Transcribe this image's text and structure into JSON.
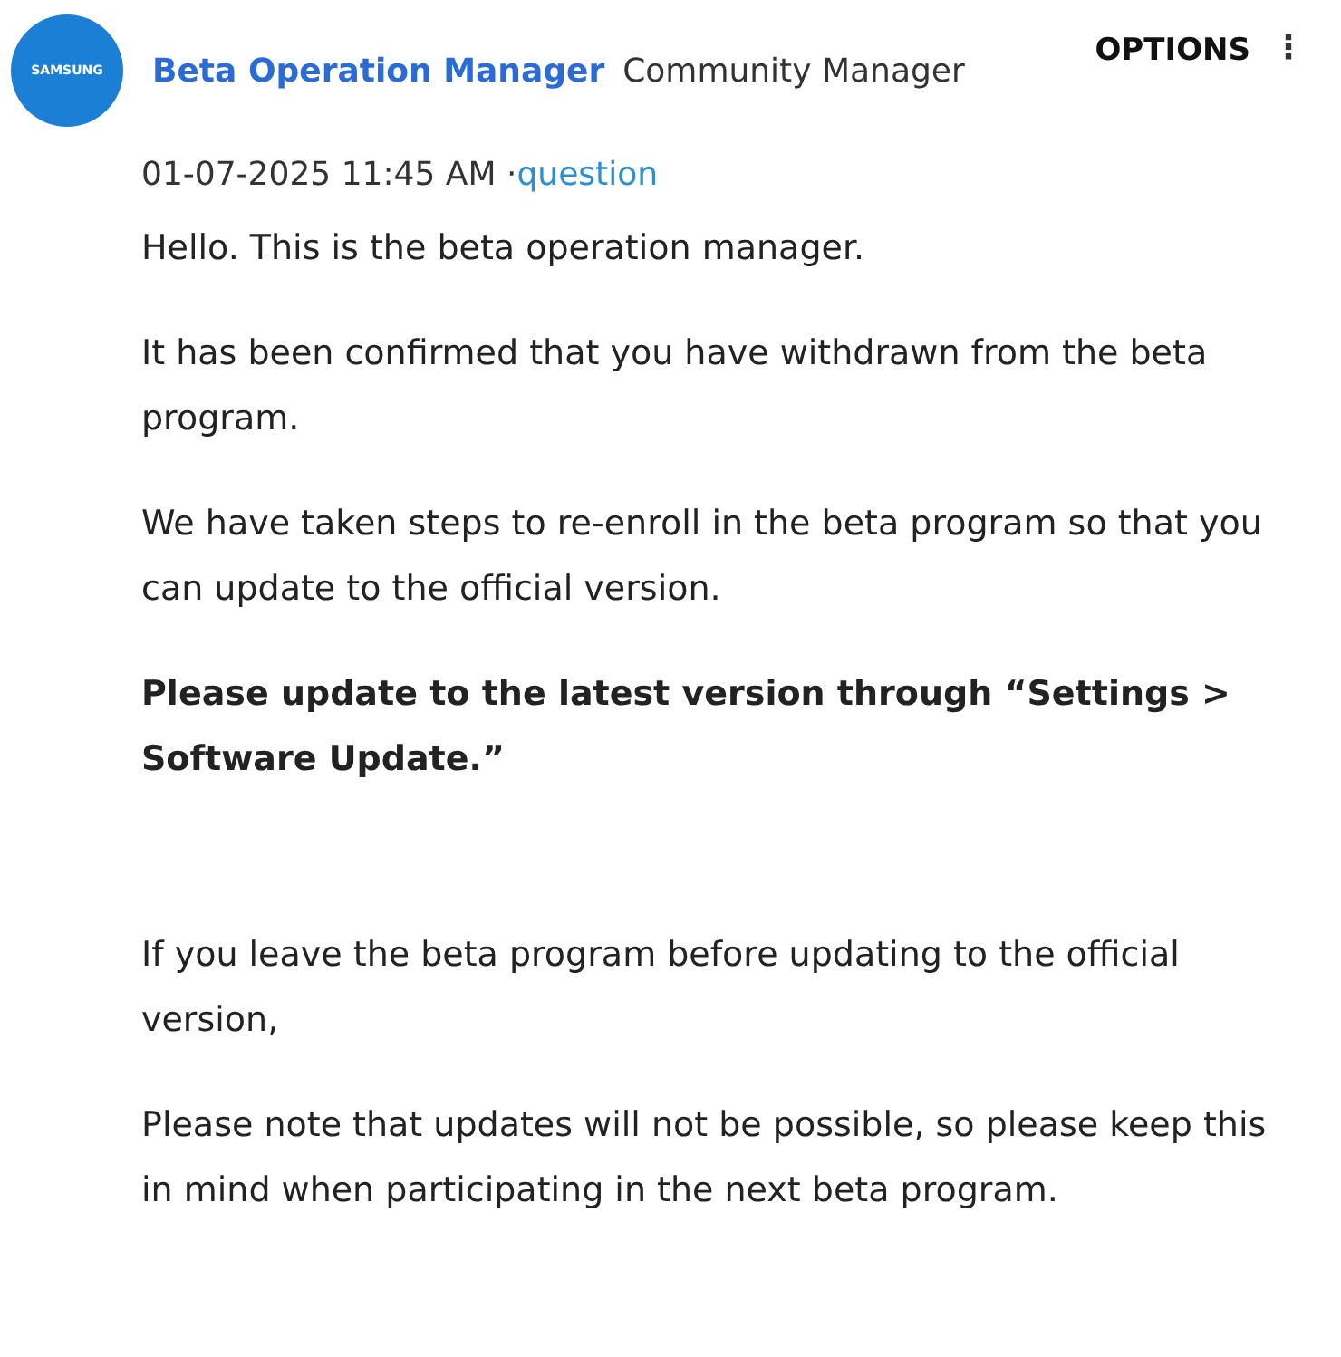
{
  "post": {
    "avatar_text": "SAMSUNG",
    "author": "Beta Operation Manager",
    "role": "Community Manager",
    "options": "OPTIONS",
    "menu": "⋮",
    "date": "01-07-2025 11:45 AM",
    "separator": "·",
    "tag": "question",
    "sections": [
      {
        "paragraphs": [
          {
            "kind": "normal",
            "text": "Hello. This is the beta operation manager."
          },
          {
            "kind": "normal",
            "text": "It has been confirmed that you have withdrawn from the beta program."
          },
          {
            "kind": "normal",
            "text": "We have taken steps to re-enroll in the beta program so that you can update to the official version."
          },
          {
            "kind": "bold",
            "text": "Please update to the latest version through “Settings > Software Update.”"
          }
        ]
      },
      {
        "paragraphs": [
          {
            "kind": "normal",
            "text": "If you leave the beta program before updating to the official version,"
          },
          {
            "kind": "normal",
            "text": "Please note that updates will not be possible, so please keep this in mind when participating in the next beta program."
          }
        ]
      }
    ]
  }
}
